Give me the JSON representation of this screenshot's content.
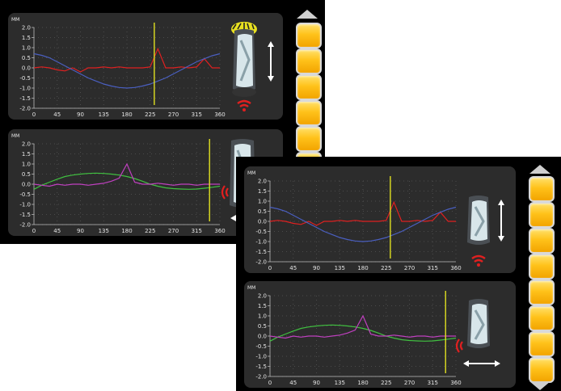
{
  "unit_label": "MM",
  "y_ticks": [
    "2.0",
    "1.5",
    "1.0",
    "0.5",
    "0.0",
    "-0.5",
    "-1.0",
    "-1.5",
    "-2.0"
  ],
  "x_ticks": [
    "0",
    "45",
    "90",
    "135",
    "180",
    "225",
    "270",
    "315",
    "360"
  ],
  "colors": {
    "background": "#000000",
    "panel": "#2c2c2c",
    "red_trace": "#e02020",
    "blue_trace": "#4a5fc0",
    "green_trace": "#40c040",
    "magenta_trace": "#c040c0",
    "marker": "#e0e020",
    "button": "#ffc21a"
  },
  "icons": [
    "wheel-icon",
    "tire-tread-icon",
    "vertical-arrow-icon",
    "horizontal-arrow-icon",
    "signal-icon",
    "scroll-up-icon",
    "scroll-down-icon"
  ],
  "chart_data": [
    {
      "type": "line",
      "x": [
        0,
        15,
        30,
        45,
        60,
        75,
        90,
        105,
        120,
        135,
        150,
        165,
        180,
        195,
        210,
        225,
        240,
        255,
        270,
        285,
        300,
        315,
        330,
        345,
        360
      ],
      "series": [
        {
          "values": [
            0.0,
            0.05,
            0.0,
            -0.1,
            -0.15,
            0.0,
            -0.2,
            0.0,
            0.0,
            0.05,
            0.0,
            0.05,
            0.0,
            0.0,
            0.0,
            0.05,
            0.95,
            0.0,
            0.0,
            0.05,
            0.0,
            0.05,
            0.45,
            0.0,
            0.0
          ],
          "color": "#e02020"
        },
        {
          "values": [
            0.7,
            0.62,
            0.5,
            0.3,
            0.1,
            -0.1,
            -0.3,
            -0.5,
            -0.65,
            -0.8,
            -0.9,
            -0.97,
            -1.0,
            -0.97,
            -0.9,
            -0.8,
            -0.65,
            -0.5,
            -0.3,
            -0.1,
            0.1,
            0.3,
            0.45,
            0.6,
            0.7
          ],
          "color": "#4a5fc0"
        }
      ],
      "marker_x": 233,
      "xlim": [
        0,
        360
      ],
      "ylim": [
        -2,
        2
      ]
    },
    {
      "type": "line",
      "x": [
        0,
        15,
        30,
        45,
        60,
        75,
        90,
        105,
        120,
        135,
        150,
        165,
        180,
        195,
        210,
        225,
        240,
        255,
        270,
        285,
        300,
        315,
        330,
        345,
        360
      ],
      "series": [
        {
          "values": [
            -0.25,
            -0.05,
            0.1,
            0.25,
            0.38,
            0.45,
            0.5,
            0.53,
            0.55,
            0.53,
            0.5,
            0.45,
            0.38,
            0.28,
            0.15,
            0.0,
            -0.1,
            -0.18,
            -0.22,
            -0.24,
            -0.25,
            -0.24,
            -0.2,
            -0.15,
            -0.1
          ],
          "color": "#40c040"
        },
        {
          "values": [
            0.0,
            -0.05,
            -0.1,
            0.0,
            -0.05,
            0.0,
            0.0,
            -0.05,
            0.0,
            0.05,
            0.15,
            0.3,
            1.0,
            0.1,
            0.0,
            0.0,
            0.05,
            0.0,
            -0.05,
            0.0,
            0.0,
            -0.05,
            0.0,
            0.0,
            0.0
          ],
          "color": "#c040c0"
        }
      ],
      "marker_x": 340,
      "xlim": [
        0,
        360
      ],
      "ylim": [
        -2,
        2
      ]
    }
  ]
}
